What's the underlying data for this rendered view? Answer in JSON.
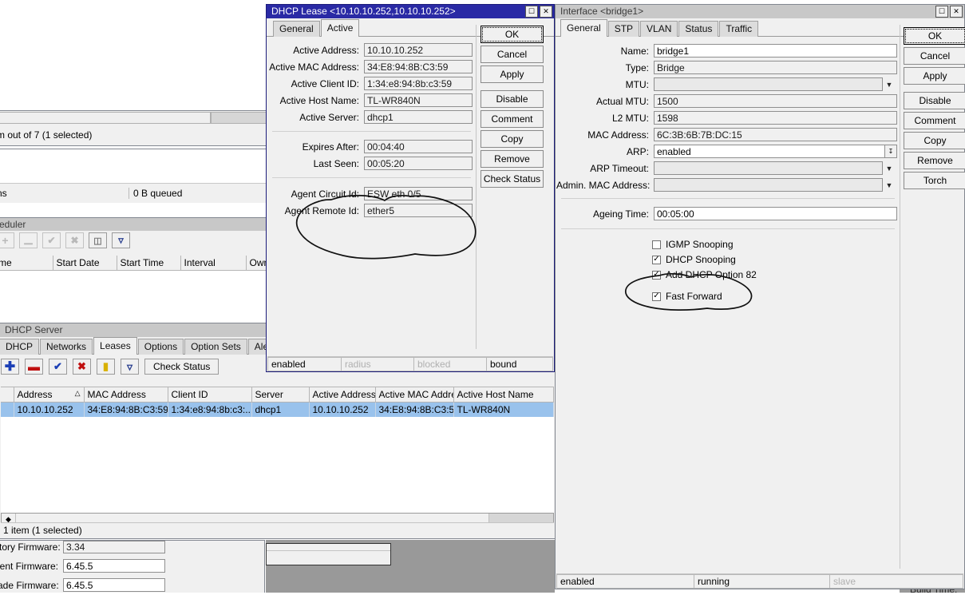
{
  "background_windows": {
    "interfacelist_status": "m out of 7 (1 selected)",
    "queue_status": "ns",
    "queue_value": "0 B queued",
    "scheduler_title": "eduler",
    "scheduler_columns": [
      "me",
      "Start Date",
      "Start Time",
      "Interval",
      "Owne"
    ],
    "firmware": [
      {
        "label": "ctory Firmware:",
        "value": "3.34"
      },
      {
        "label": "rent Firmware:",
        "value": "6.45.5"
      },
      {
        "label": "rade Firmware:",
        "value": "6.45.5"
      }
    ],
    "build_time_label": "Build Time:"
  },
  "dhcp_server_window": {
    "title": "DHCP Server",
    "tabs": [
      {
        "label": "DHCP",
        "selected": false
      },
      {
        "label": "Networks",
        "selected": false
      },
      {
        "label": "Leases",
        "selected": true
      },
      {
        "label": "Options",
        "selected": false
      },
      {
        "label": "Option Sets",
        "selected": false
      },
      {
        "label": "Alerts",
        "selected": false
      }
    ],
    "toolbar": {
      "add": "+",
      "remove": "—",
      "enable": "✔",
      "disable": "✖",
      "comment": "▭",
      "filter": "▽",
      "check_status": "Check Status"
    },
    "columns": [
      "Address",
      "MAC Address",
      "Client ID",
      "Server",
      "Active Address",
      "Active MAC Addre...",
      "Active Host Name"
    ],
    "rows": [
      {
        "address": "10.10.10.252",
        "mac_address": "34:E8:94:8B:C3:59",
        "client_id": "1:34:e8:94:8b:c3:...",
        "server": "dhcp1",
        "active_address": "10.10.10.252",
        "active_mac": "34:E8:94:8B:C3:59",
        "active_host_name": "TL-WR840N"
      }
    ],
    "status": "1 item (1 selected)"
  },
  "dhcp_lease_window": {
    "title": "DHCP Lease <10.10.10.252,10.10.10.252>",
    "tabs": [
      {
        "label": "General",
        "selected": false
      },
      {
        "label": "Active",
        "selected": true
      }
    ],
    "fields": [
      {
        "label": "Active Address:",
        "value": "10.10.10.252"
      },
      {
        "label": "Active MAC Address:",
        "value": "34:E8:94:8B:C3:59"
      },
      {
        "label": "Active Client ID:",
        "value": "1:34:e8:94:8b:c3:59"
      },
      {
        "label": "Active Host Name:",
        "value": "TL-WR840N"
      },
      {
        "label": "Active Server:",
        "value": "dhcp1"
      }
    ],
    "timing_fields": [
      {
        "label": "Expires After:",
        "value": "00:04:40"
      },
      {
        "label": "Last Seen:",
        "value": "00:05:20"
      }
    ],
    "agent_fields": [
      {
        "label": "Agent Circuit Id:",
        "value": "ESW eth 0/5"
      },
      {
        "label": "Agent Remote Id:",
        "value": "ether5"
      }
    ],
    "buttons": [
      "OK",
      "Cancel",
      "Apply",
      "Disable",
      "Comment",
      "Copy",
      "Remove",
      "Check Status"
    ],
    "status": [
      {
        "text": "enabled",
        "dim": false
      },
      {
        "text": "radius",
        "dim": true
      },
      {
        "text": "blocked",
        "dim": true
      },
      {
        "text": "bound",
        "dim": false
      }
    ]
  },
  "interface_window": {
    "title": "Interface <bridge1>",
    "tabs": [
      {
        "label": "General",
        "selected": true
      },
      {
        "label": "STP",
        "selected": false
      },
      {
        "label": "VLAN",
        "selected": false
      },
      {
        "label": "Status",
        "selected": false
      },
      {
        "label": "Traffic",
        "selected": false
      }
    ],
    "fields": [
      {
        "label": "Name:",
        "value": "bridge1",
        "kind": "text"
      },
      {
        "label": "Type:",
        "value": "Bridge",
        "kind": "readonly"
      },
      {
        "label": "MTU:",
        "value": "",
        "kind": "dropdown"
      },
      {
        "label": "Actual MTU:",
        "value": "1500",
        "kind": "readonly"
      },
      {
        "label": "L2 MTU:",
        "value": "1598",
        "kind": "readonly"
      },
      {
        "label": "MAC Address:",
        "value": "6C:3B:6B:7B:DC:15",
        "kind": "readonly"
      },
      {
        "label": "ARP:",
        "value": "enabled",
        "kind": "select"
      },
      {
        "label": "ARP Timeout:",
        "value": "",
        "kind": "dropdown"
      },
      {
        "label": "Admin. MAC Address:",
        "value": "",
        "kind": "dropdown"
      }
    ],
    "ageing": {
      "label": "Ageing Time:",
      "value": "00:05:00"
    },
    "checkboxes": [
      {
        "label": "IGMP Snooping",
        "checked": false
      },
      {
        "label": "DHCP Snooping",
        "checked": true
      },
      {
        "label": "Add DHCP Option 82",
        "checked": true
      },
      {
        "label": "Fast Forward",
        "checked": true
      }
    ],
    "buttons": [
      "OK",
      "Cancel",
      "Apply",
      "Disable",
      "Comment",
      "Copy",
      "Remove",
      "Torch"
    ],
    "status": [
      {
        "text": "enabled",
        "dim": false
      },
      {
        "text": "running",
        "dim": false
      },
      {
        "text": "slave",
        "dim": true
      }
    ]
  },
  "annotations": {
    "agent_id_circle": "hand-drawn-oval-around-agent-ids",
    "dhcp_snooping_circle": "hand-drawn-oval-around-dhcp-snooping-options"
  },
  "colors": {
    "active_title": "#2a2aa5",
    "inactive_title": "#c8c8c8",
    "selection": "#99c2ec",
    "face": "#f0f0f0",
    "desktop": "#999999"
  }
}
